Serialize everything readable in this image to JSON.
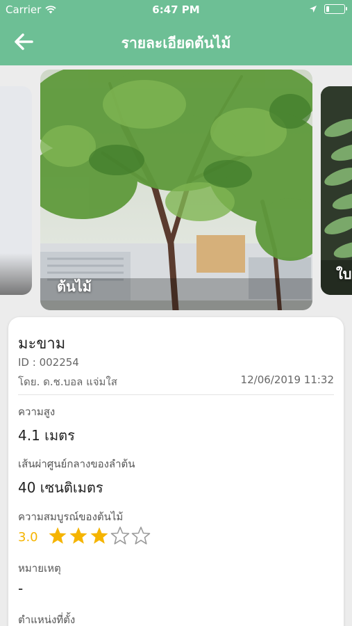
{
  "status_bar": {
    "carrier": "Carrier",
    "time": "6:47 PM",
    "battery_level": 0.15
  },
  "nav": {
    "title": "รายละเอียดต้นไม้"
  },
  "carousel": {
    "slides": [
      {
        "label": ""
      },
      {
        "label": "ต้นไม้"
      },
      {
        "label": "ใบ"
      }
    ]
  },
  "tree": {
    "name": "มะขาม",
    "id_label": "ID : 002254",
    "recorder": "โดย. ด.ช.บอล แจ่มใส",
    "recorded_at": "12/06/2019 11:32",
    "height_label": "ความสูง",
    "height_value": "4.1 เมตร",
    "diameter_label": "เส้นผ่าศูนย์กลางของลำต้น",
    "diameter_value": "40 เซนติเมตร",
    "health_label": "ความสมบูรณ์ของต้นไม้",
    "health_rating_text": "3.0",
    "health_rating": 3,
    "health_rating_max": 5,
    "note_label": "หมายเหตุ",
    "note_value": "-",
    "location_label": "ตำแหน่งที่ตั้ง"
  },
  "colors": {
    "header": "#6dbf95",
    "star": "#f5b400",
    "star_empty": "#9a9a9a"
  }
}
